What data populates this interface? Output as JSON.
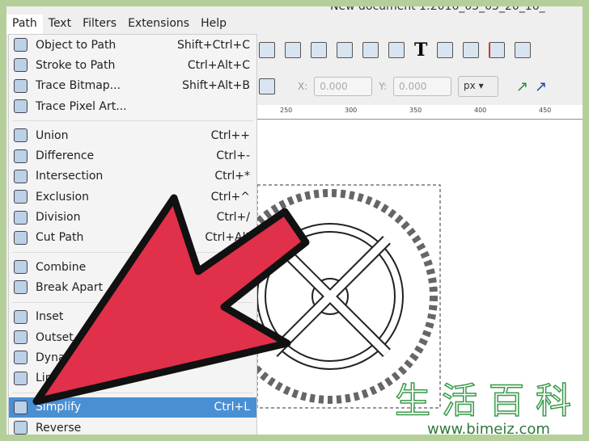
{
  "window": {
    "title": "New document 1:2016_05_05_20_16_"
  },
  "menubar": [
    "Path",
    "Text",
    "Filters",
    "Extensions",
    "Help"
  ],
  "menu": {
    "groups": [
      [
        {
          "label": "Object to Path",
          "shortcut": "Shift+Ctrl+C",
          "icon": "object-to-path-icon"
        },
        {
          "label": "Stroke to Path",
          "shortcut": "Ctrl+Alt+C",
          "icon": "stroke-to-path-icon"
        },
        {
          "label": "Trace Bitmap...",
          "shortcut": "Shift+Alt+B",
          "icon": "trace-bitmap-icon"
        },
        {
          "label": "Trace Pixel Art...",
          "shortcut": "",
          "icon": "trace-pixel-art-icon"
        }
      ],
      [
        {
          "label": "Union",
          "shortcut": "Ctrl++",
          "icon": "union-icon"
        },
        {
          "label": "Difference",
          "shortcut": "Ctrl+-",
          "icon": "difference-icon"
        },
        {
          "label": "Intersection",
          "shortcut": "Ctrl+*",
          "icon": "intersection-icon"
        },
        {
          "label": "Exclusion",
          "shortcut": "Ctrl+^",
          "icon": "exclusion-icon"
        },
        {
          "label": "Division",
          "shortcut": "Ctrl+/",
          "icon": "division-icon"
        },
        {
          "label": "Cut Path",
          "shortcut": "Ctrl+Alt",
          "icon": "cut-path-icon"
        }
      ],
      [
        {
          "label": "Combine",
          "shortcut": "",
          "icon": "combine-icon"
        },
        {
          "label": "Break Apart",
          "shortcut": "",
          "icon": "break-apart-icon"
        }
      ],
      [
        {
          "label": "Inset",
          "shortcut": "",
          "icon": "inset-icon"
        },
        {
          "label": "Outset",
          "shortcut": "",
          "icon": "outset-icon"
        },
        {
          "label": "Dynamic",
          "shortcut": "",
          "icon": "dynamic-offset-icon"
        },
        {
          "label": "Linked",
          "shortcut": "",
          "icon": "linked-offset-icon"
        }
      ],
      [
        {
          "label": "Simplify",
          "shortcut": "Ctrl+L",
          "icon": "simplify-icon",
          "selected": true
        },
        {
          "label": "Reverse",
          "shortcut": "",
          "icon": "reverse-icon"
        }
      ]
    ]
  },
  "toolbar": {
    "x_label": "X:",
    "x_value": "0.000",
    "y_label": "Y:",
    "y_value": "0.000",
    "unit": "px"
  },
  "ruler": [
    "250",
    "300",
    "350",
    "400",
    "450"
  ],
  "watermark": {
    "chinese": "生活百科",
    "url": "www.bimeiz.com"
  },
  "colors": {
    "arrow": "#e0304a",
    "highlight": "#4a8fd4",
    "border": "#b5cf9a"
  }
}
